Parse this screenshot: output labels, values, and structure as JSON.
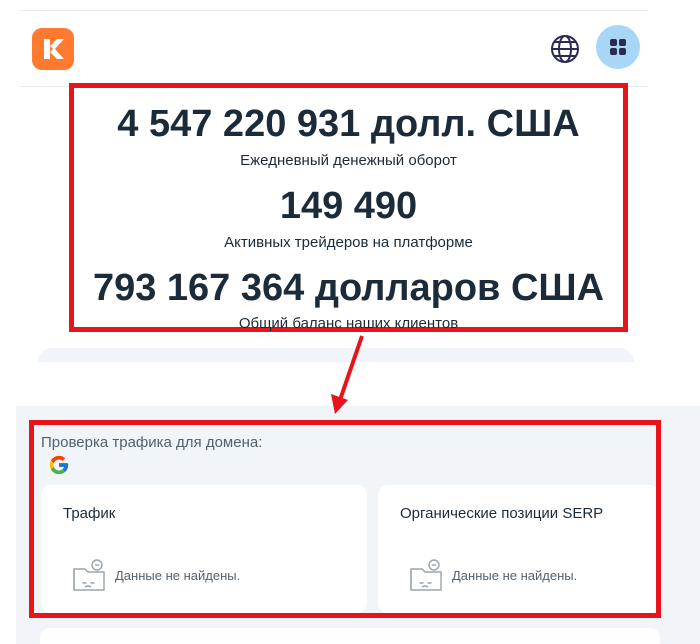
{
  "stats": [
    {
      "value": "4 547 220 931 долл. США",
      "label": "Ежедневный денежный оборот"
    },
    {
      "value": "149 490",
      "label": "Активных трейдеров на платформе"
    },
    {
      "value": "793 167 364 долларов США",
      "label": "Общий баланс наших клиентов"
    }
  ],
  "traffic": {
    "title": "Проверка трафика для домена:",
    "cards": [
      {
        "title": "Трафик",
        "empty_text": "Данные не найдены."
      },
      {
        "title": "Органические позиции SERP",
        "empty_text": "Данные не найдены."
      }
    ]
  },
  "icons": {
    "logo": "brand-logo-icon",
    "globe": "globe-icon",
    "menu": "grid-menu-icon",
    "google": "google-icon",
    "empty": "empty-folder-icon"
  },
  "colors": {
    "logo": "#ff7a2e",
    "menu_button": "#a8d6f7",
    "highlight": "#e8141b",
    "text_dark": "#1c2b3a",
    "panel_bg": "#f1f4f8"
  }
}
